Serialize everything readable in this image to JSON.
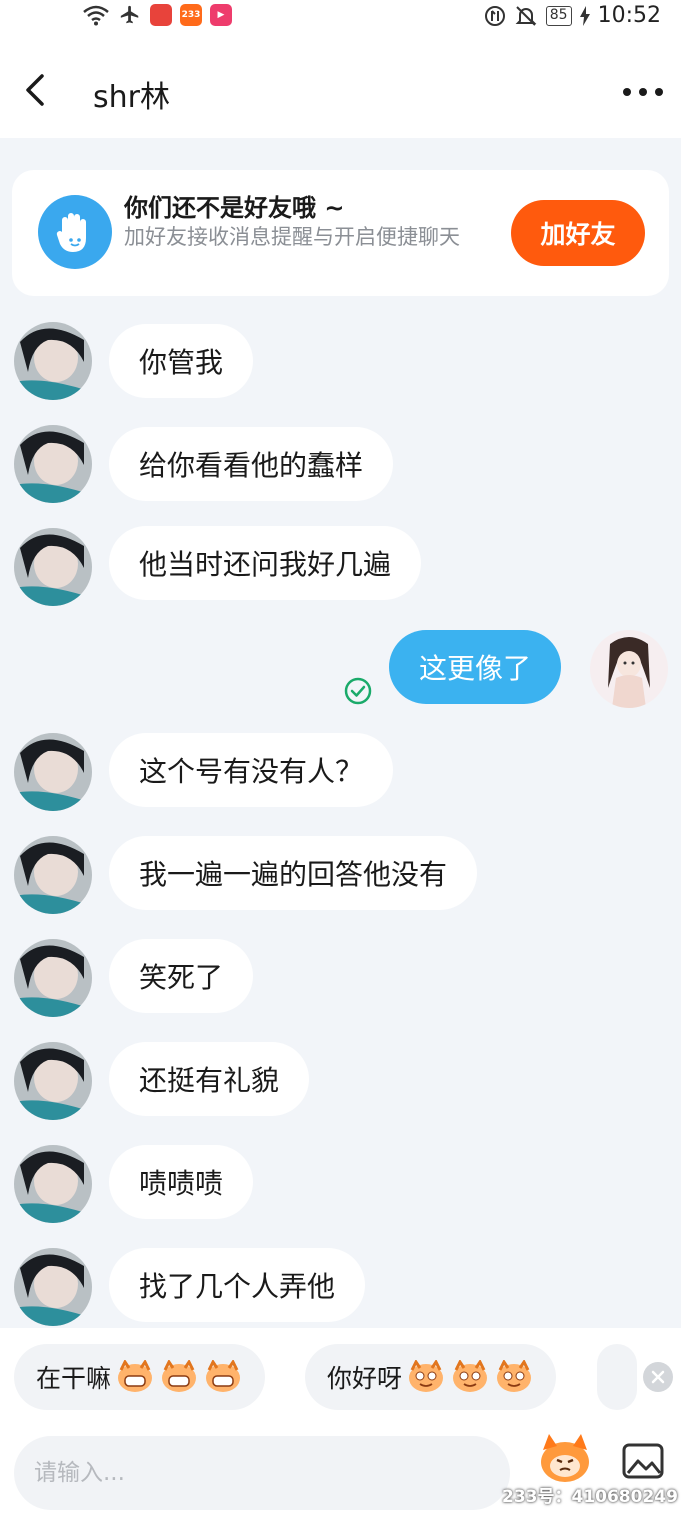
{
  "status_bar": {
    "time": "10:52",
    "battery": "85",
    "app_badge": "233"
  },
  "header": {
    "title": "shr林"
  },
  "friend_banner": {
    "title": "你们还不是好友哦 ~",
    "description": "加好友接收消息提醒与开启便捷聊天",
    "button_label": "加好友"
  },
  "messages": [
    {
      "from": "other",
      "text": "你管我"
    },
    {
      "from": "other",
      "text": "给你看看他的蠢样"
    },
    {
      "from": "other",
      "text": "他当时还问我好几遍"
    },
    {
      "from": "self",
      "text": "这更像了",
      "read": true
    },
    {
      "from": "other",
      "text": "这个号有没有人？"
    },
    {
      "from": "other",
      "text": "我一遍一遍的回答他没有"
    },
    {
      "from": "other",
      "text": "笑死了"
    },
    {
      "from": "other",
      "text": "还挺有礼貌"
    },
    {
      "from": "other",
      "text": "啧啧啧"
    },
    {
      "from": "other",
      "text": "找了几个人弄他"
    }
  ],
  "quick_replies": [
    {
      "text": "在干嘛"
    },
    {
      "text": "你好呀"
    }
  ],
  "composer": {
    "placeholder": "请输入..."
  },
  "watermark": "233号：410680249",
  "colors": {
    "accent_blue": "#3bb2f0",
    "add_friend_orange": "#ff5a0d",
    "background": "#f2f5f9"
  }
}
